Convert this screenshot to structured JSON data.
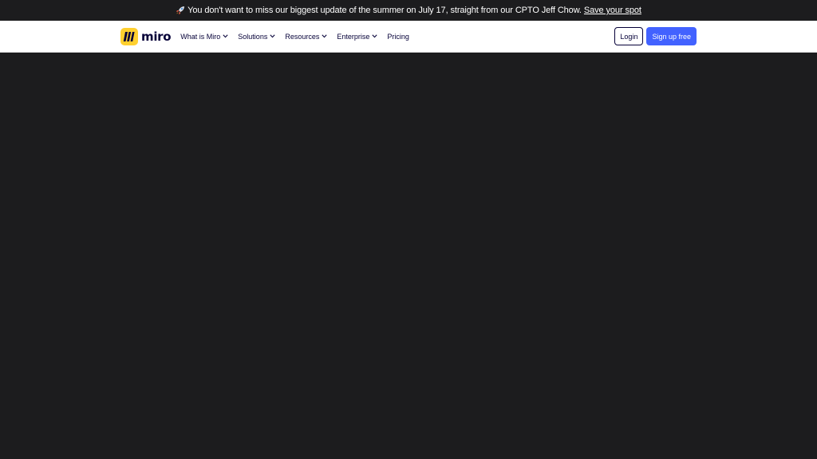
{
  "announcement": {
    "icon": "rocket-icon",
    "message": "You don't want to miss our biggest update of the summer on July 17, straight from our CPTO Jeff Chow.",
    "cta_label": "Save your spot"
  },
  "navbar": {
    "logo_text": "miro",
    "menu": [
      {
        "label": "What is Miro",
        "has_dropdown": true
      },
      {
        "label": "Solutions",
        "has_dropdown": true
      },
      {
        "label": "Resources",
        "has_dropdown": true
      },
      {
        "label": "Enterprise",
        "has_dropdown": true
      },
      {
        "label": "Pricing",
        "has_dropdown": false
      }
    ],
    "login_label": "Login",
    "signup_label": "Sign up free"
  },
  "colors": {
    "brand_yellow": "#ffd02f",
    "primary_blue": "#4262ff",
    "text_dark": "#050038",
    "page_dark": "#1c1c1e"
  }
}
